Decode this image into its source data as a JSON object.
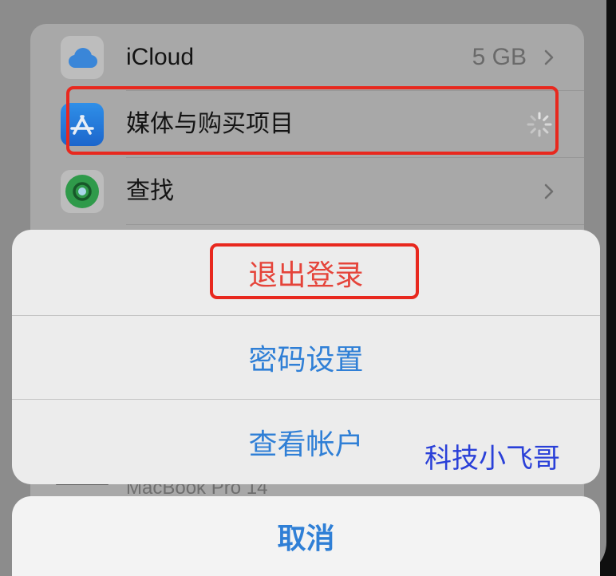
{
  "settings_list": {
    "rows": [
      {
        "label": "iCloud",
        "value": "5 GB",
        "icon": "icloud-icon",
        "trailing_icon": "chevron-right-icon"
      },
      {
        "label": "媒体与购买项目",
        "icon": "app-store-icon",
        "trailing_icon": "loading-spinner-icon"
      },
      {
        "label": "查找",
        "icon": "find-my-icon",
        "trailing_icon": "chevron-right-icon"
      }
    ],
    "partially_hidden_row": {
      "label": "MacBook Pro 14",
      "icon": "laptop-icon"
    }
  },
  "action_sheet": {
    "actions": [
      {
        "label": "退出登录",
        "color": "#e5443a"
      },
      {
        "label": "密码设置",
        "color": "#2f7fd6"
      },
      {
        "label": "查看帐户",
        "color": "#2f7fd6"
      }
    ],
    "cancel": {
      "label": "取消",
      "color": "#2f7fd6"
    }
  },
  "annotations": {
    "highlight_color": "#e8281e"
  },
  "watermark": {
    "text": "科技小飞哥",
    "color": "#2a40d8"
  }
}
